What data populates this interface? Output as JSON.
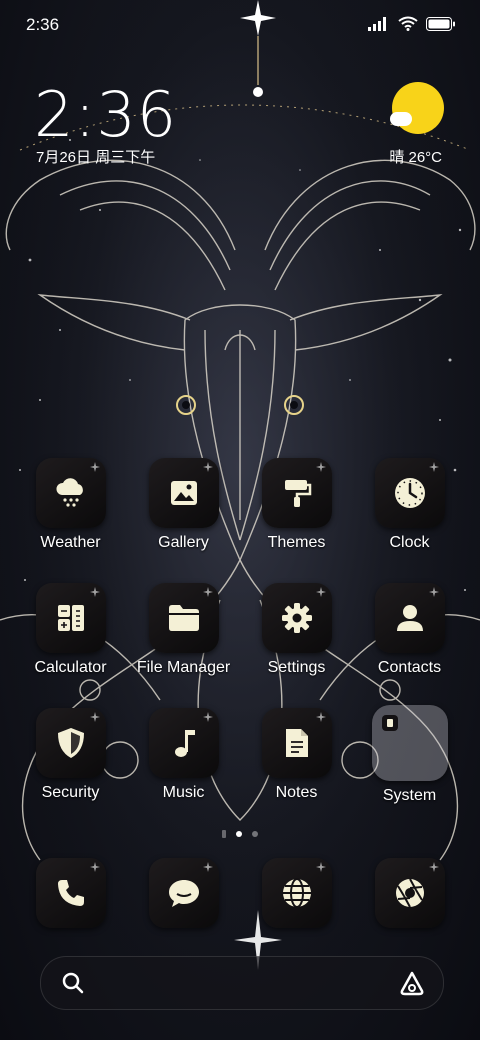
{
  "status_bar": {
    "time": "2:36"
  },
  "clock_widget": {
    "time": "2:36",
    "date": "7月26日 周三下午"
  },
  "weather_widget": {
    "text": "晴 26°C"
  },
  "apps": [
    {
      "label": "Weather",
      "icon": "weather-snow-cloud-icon"
    },
    {
      "label": "Gallery",
      "icon": "image-icon"
    },
    {
      "label": "Themes",
      "icon": "paint-roller-icon"
    },
    {
      "label": "Clock",
      "icon": "clock-icon"
    },
    {
      "label": "Calculator",
      "icon": "calculator-icon"
    },
    {
      "label": "File Manager",
      "icon": "folder-icon"
    },
    {
      "label": "Settings",
      "icon": "gear-icon"
    },
    {
      "label": "Contacts",
      "icon": "person-icon"
    },
    {
      "label": "Security",
      "icon": "shield-icon"
    },
    {
      "label": "Music",
      "icon": "music-note-icon"
    },
    {
      "label": "Notes",
      "icon": "document-icon"
    },
    {
      "label": "System",
      "icon": "folder-grid-icon"
    }
  ],
  "dock": [
    {
      "icon": "phone-icon"
    },
    {
      "icon": "message-icon"
    },
    {
      "icon": "globe-icon"
    },
    {
      "icon": "camera-aperture-icon"
    }
  ],
  "colors": {
    "icon_fg": "#f4f0d6",
    "sun": "#f8d319",
    "icon_bg": "#131113"
  }
}
